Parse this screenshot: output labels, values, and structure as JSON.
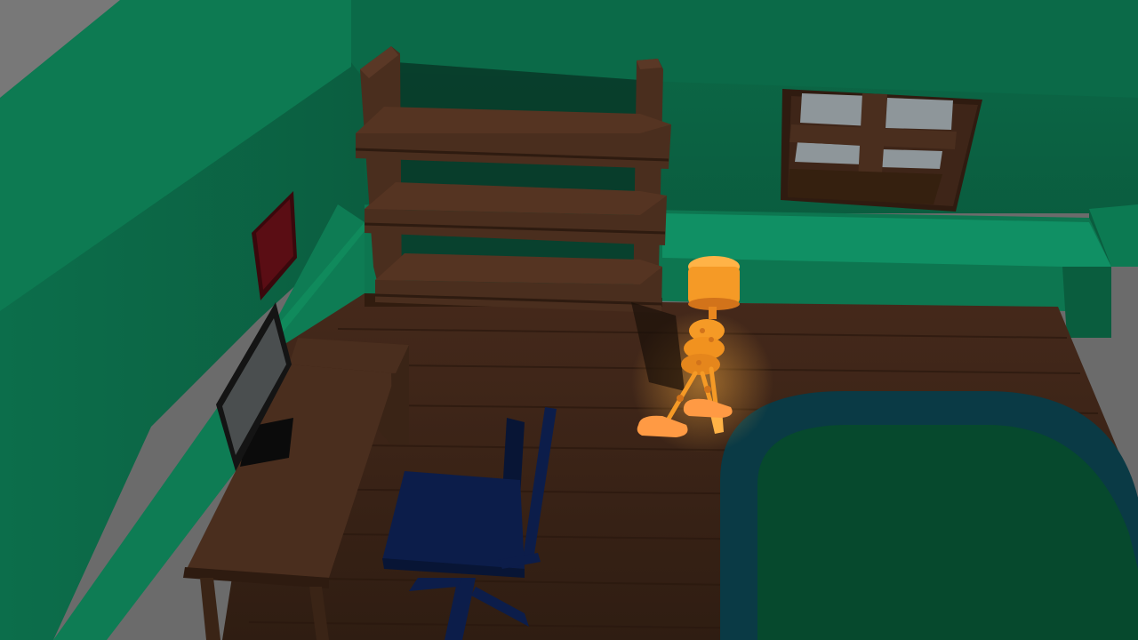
{
  "scene": {
    "type": "3d-rendered-room",
    "objects": [
      "back-wall",
      "left-wall",
      "wooden-floor",
      "bookshelf",
      "window",
      "wall-painting",
      "computer-monitor",
      "desk",
      "office-chair",
      "rug",
      "character"
    ]
  },
  "colors": {
    "wall": "#0f7f57",
    "wall_dark": "#0a5f40",
    "wall_trim": "#127a55",
    "floor": "#3d2619",
    "wood": "#4a2e1e",
    "wood_dark": "#2e1b10",
    "window_glass": "#8e969a",
    "chair": "#0c1d4a",
    "rug_border": "#0a3a45",
    "rug_inner": "#06492d",
    "character": "#f59a26",
    "character_shade": "#d2731a",
    "painting": "#5a0d14",
    "monitor_screen": "#4a4e4f"
  }
}
